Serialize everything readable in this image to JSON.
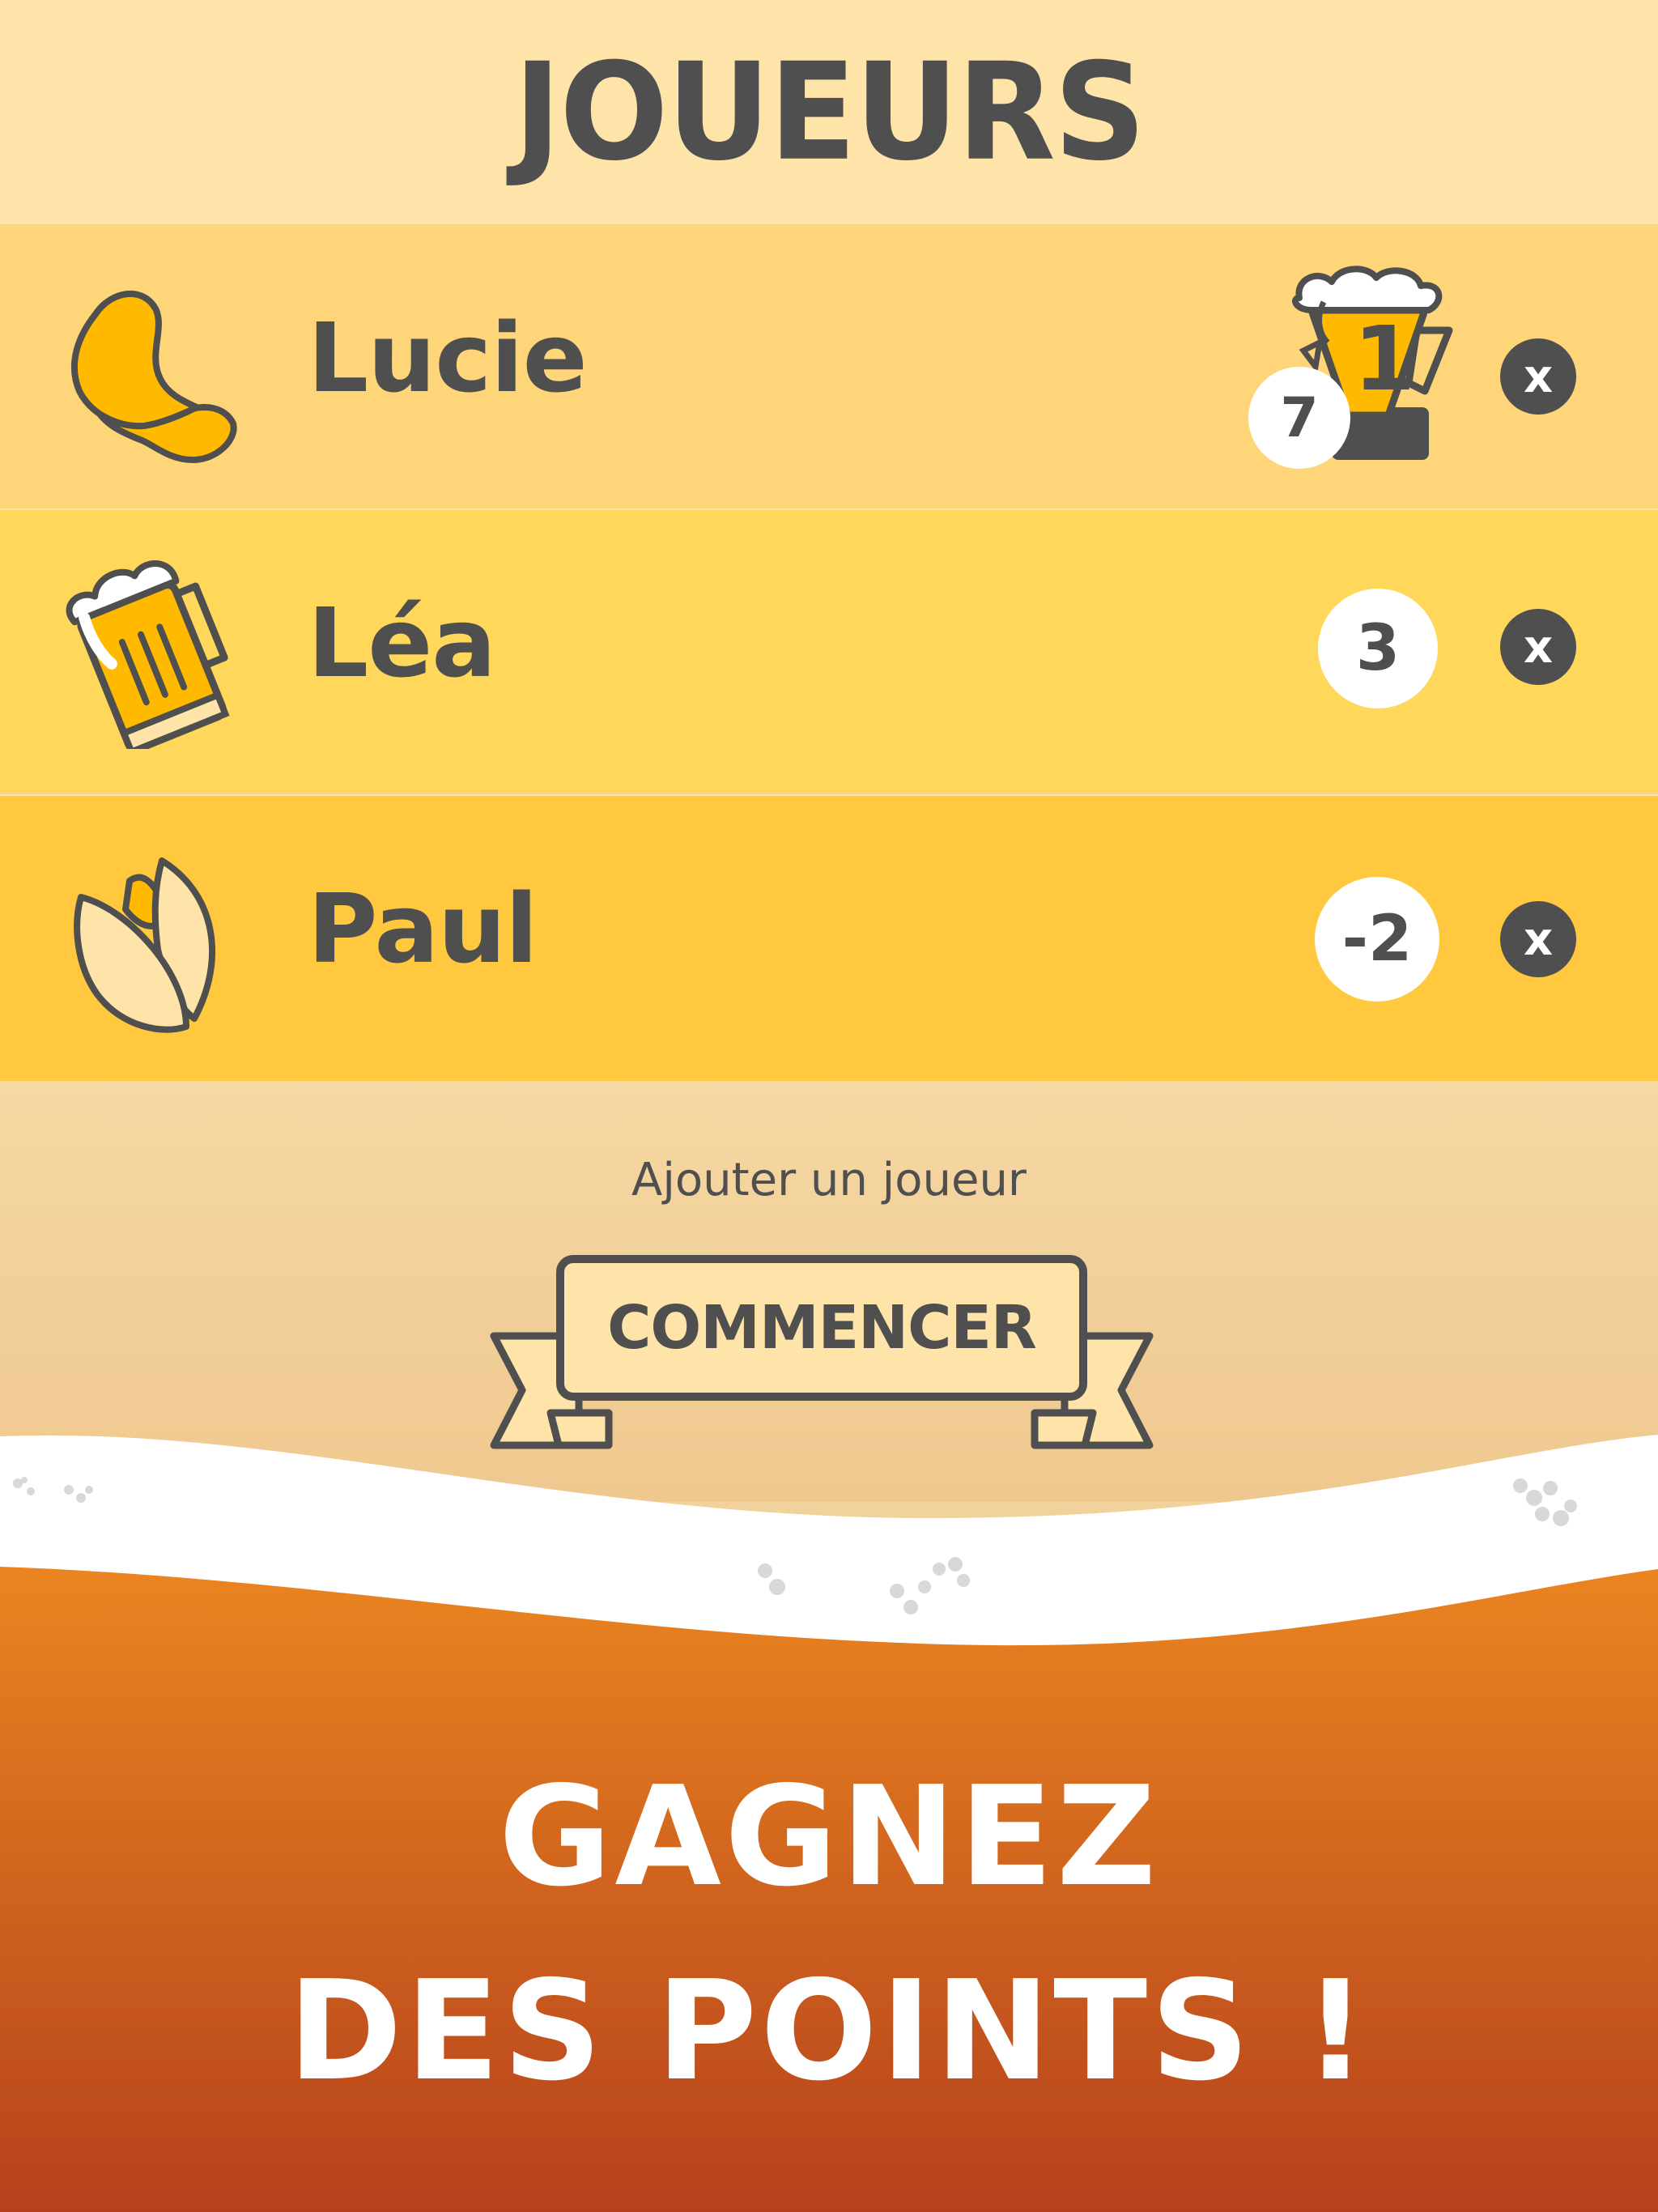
{
  "header": {
    "title": "JOUEURS"
  },
  "players": [
    {
      "name": "Lucie",
      "icon": "chip-icon",
      "score": "7",
      "rank_badge": "1"
    },
    {
      "name": "Léa",
      "icon": "beer-mug-icon",
      "score": "3"
    },
    {
      "name": "Paul",
      "icon": "pistachio-icon",
      "score": "-2"
    }
  ],
  "remove_label": "x",
  "actions": {
    "add_player": "Ajouter un joueur",
    "start": "COMMENCER"
  },
  "promo": {
    "line1": "GAGNEZ",
    "line2": "DES POINTS !"
  },
  "colors": {
    "text": "#4f4f4f",
    "row1": "#ffd57a",
    "row2": "#ffd75a",
    "row3": "#ffc83e",
    "accent": "#ffba00",
    "bottom_top": "#ea8520",
    "bottom_bottom": "#b5411c"
  }
}
